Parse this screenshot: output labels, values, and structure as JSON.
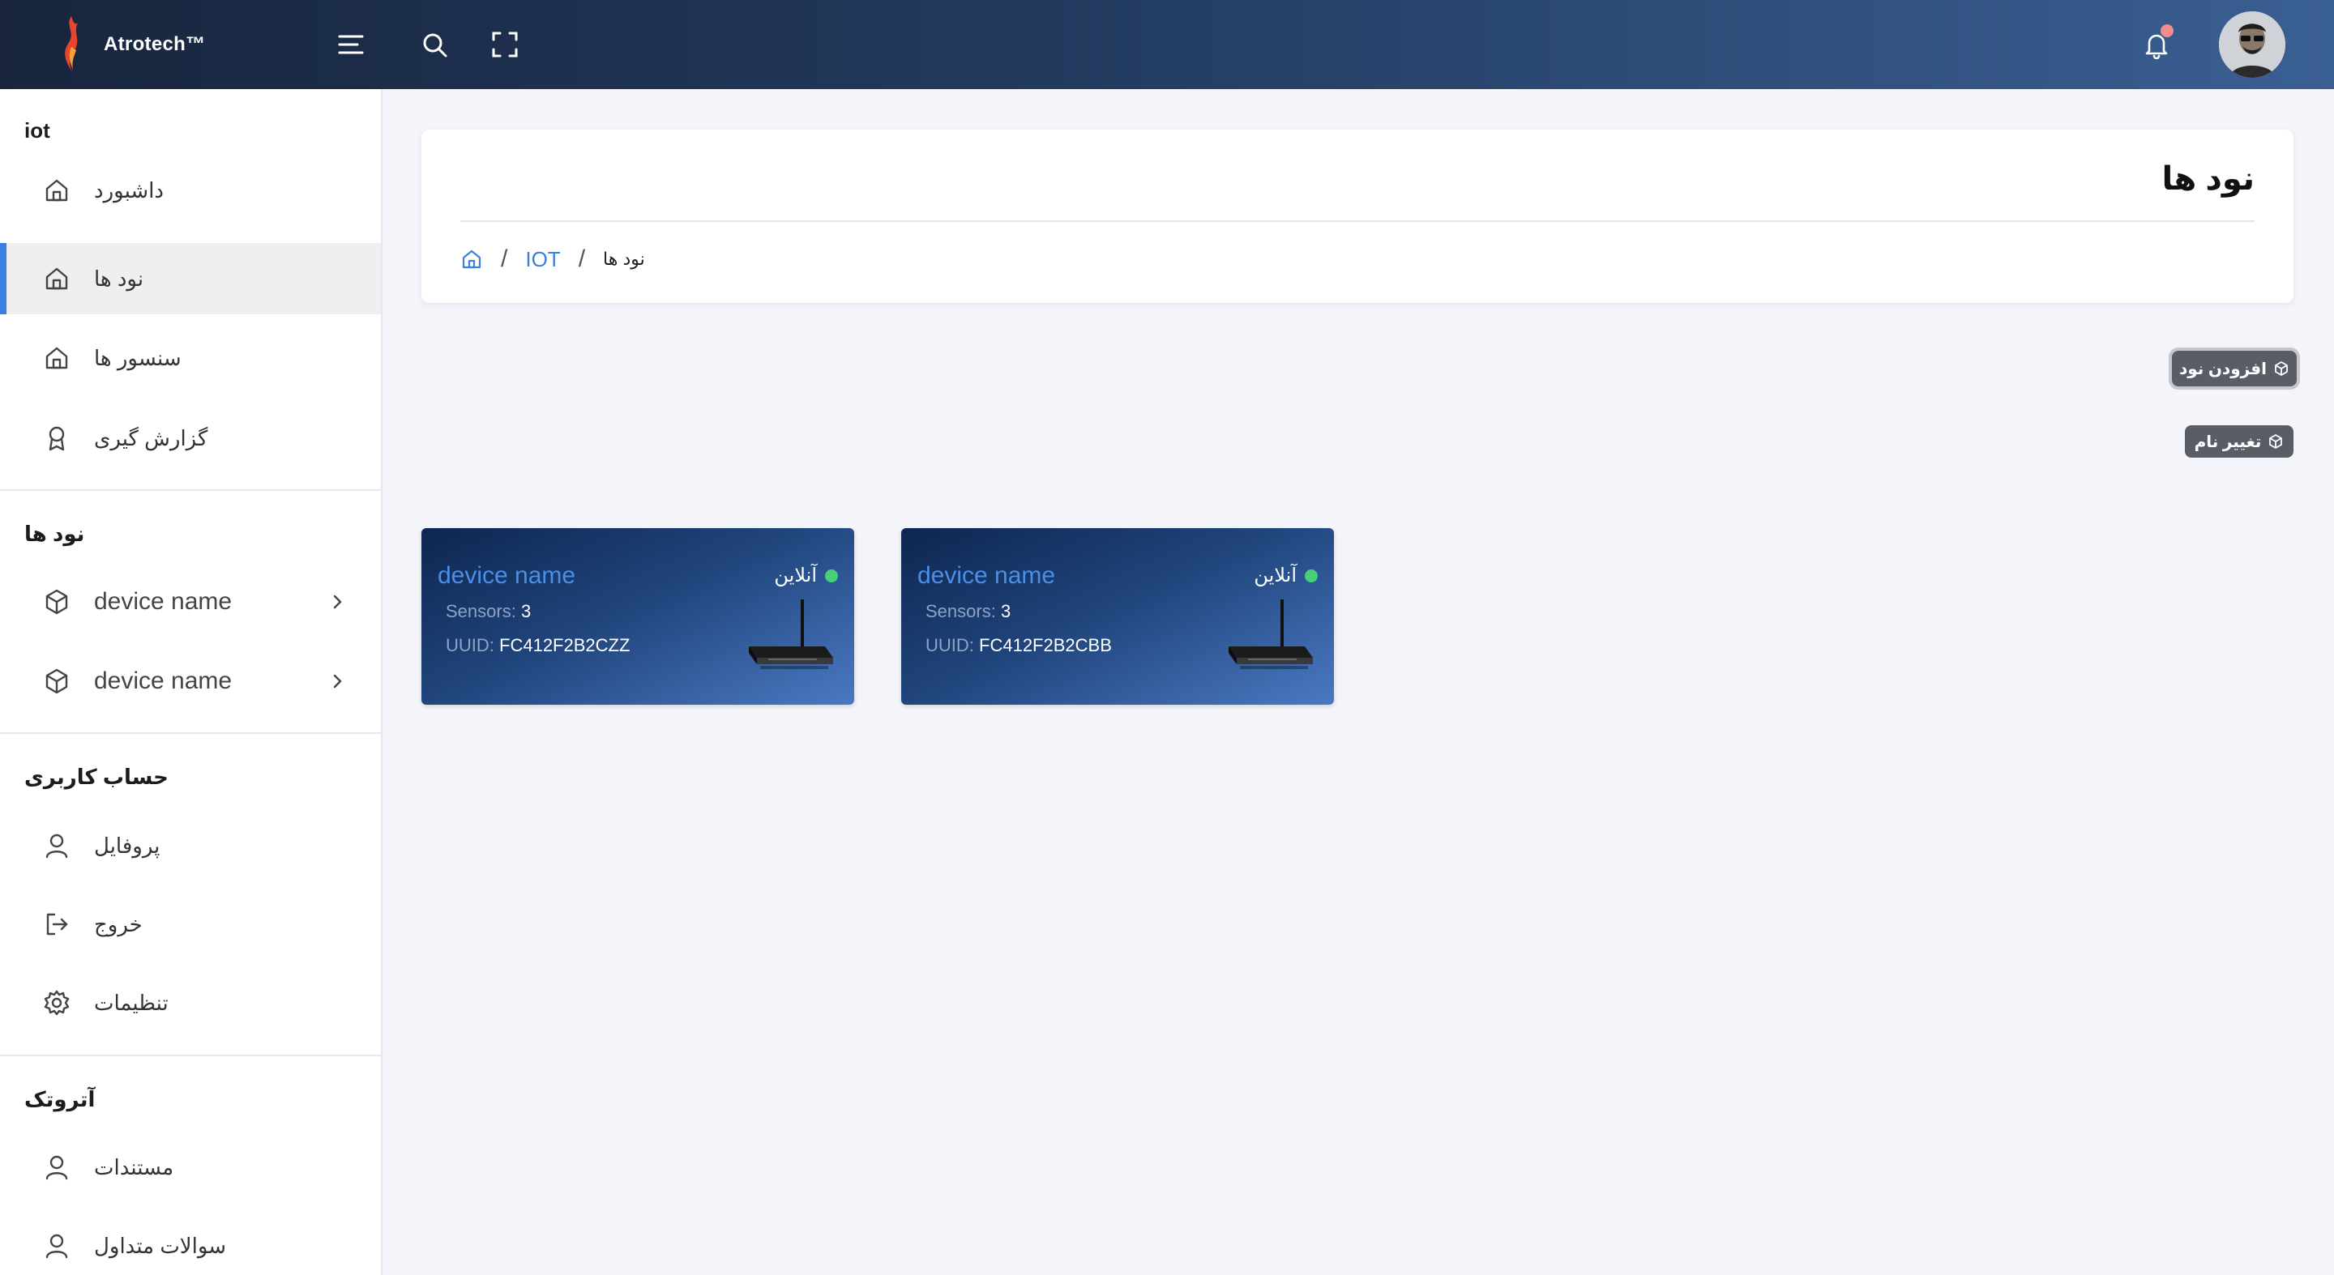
{
  "brand": {
    "name": "Atrotech™"
  },
  "topbar": {
    "menu_icon": "menu-icon",
    "search_icon": "search-icon",
    "fullscreen_icon": "fullscreen-icon",
    "notification_icon": "bell-icon",
    "notification_dot_color": "#f28b8b"
  },
  "sidebar": {
    "sections": [
      {
        "title": "iot",
        "items": [
          {
            "label": "داشبورد",
            "icon": "home-icon",
            "active": false
          },
          {
            "label": "نود ها",
            "icon": "home-icon",
            "active": true
          },
          {
            "label": "سنسور ها",
            "icon": "home-icon",
            "active": false
          },
          {
            "label": "گزارش گیری",
            "icon": "award-icon",
            "active": false
          }
        ]
      },
      {
        "title": "نود ها",
        "items": [
          {
            "label": "device name",
            "icon": "cube-icon"
          },
          {
            "label": "device name",
            "icon": "cube-icon"
          }
        ]
      },
      {
        "title": "حساب کاربری",
        "items": [
          {
            "label": "پروفایل",
            "icon": "user-icon"
          },
          {
            "label": "خروج",
            "icon": "logout-icon"
          },
          {
            "label": "تنظیمات",
            "icon": "settings-icon"
          }
        ]
      },
      {
        "title": "آتروتک",
        "items": [
          {
            "label": "مستندات",
            "icon": "user-icon"
          },
          {
            "label": "سوالات متداول",
            "icon": "user-icon"
          }
        ]
      }
    ]
  },
  "header": {
    "title": "نود ها",
    "breadcrumb": {
      "home_icon": "home-icon",
      "items": [
        "IOT",
        "نود ها"
      ]
    }
  },
  "actions": {
    "add_node": "افزودن نود",
    "rename": "تغییر نام"
  },
  "devices": [
    {
      "name": "device name",
      "status": "آنلاین",
      "sensors_label": "Sensors:",
      "sensors": "3",
      "uuid_label": "UUID:",
      "uuid": "FC412F2B2CZZ"
    },
    {
      "name": "device name",
      "status": "آنلاین",
      "sensors_label": "Sensors:",
      "sensors": "3",
      "uuid_label": "UUID:",
      "uuid": "FC412F2B2CBB"
    }
  ],
  "colors": {
    "accent": "#3b7fe0",
    "online": "#46d07a",
    "topbar_start": "#18253d",
    "topbar_end": "#3a5f93"
  }
}
